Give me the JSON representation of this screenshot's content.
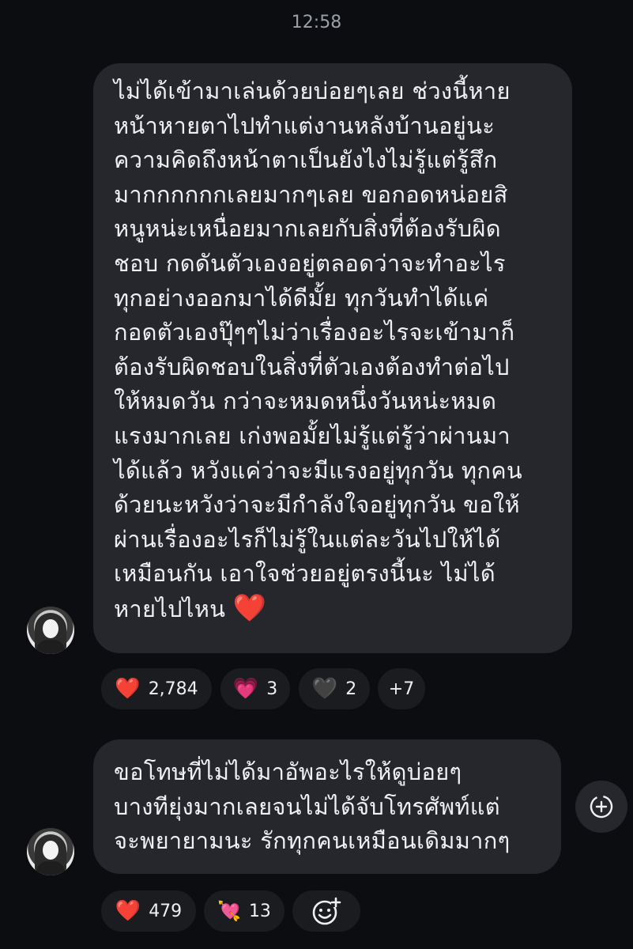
{
  "timestamp": "12:58",
  "messages": [
    {
      "lines": [
        "ไม่ได้เข้ามาเล่นด้วยบ่อยๆเลย ช่วงนี้หาย",
        "หน้าหายตาไปทำแต่งานหลังบ้านอยู่นะ",
        "ความคิดถึงหน้าตาเป็นยังไงไม่รู้แต่รู้สึก",
        "มากกกกกกเลยมากๆเลย ขอกอดหน่อยสิ",
        "หนูหน่ะเหนื่อยมากเลยกับสิ่งที่ต้องรับผิด",
        "ชอบ กดดันตัวเองอยู่ตลอดว่าจะทำอะไร",
        "ทุกอย่างออกมาได้ดีมั้ย ทุกวันทำได้แค่",
        "กอดตัวเองปุ๊ๆๆไม่ว่าเรื่องอะไรจะเข้ามาก็",
        "ต้องรับผิดชอบในสิ่งที่ตัวเองต้องทำต่อไป",
        "ให้หมดวัน กว่าจะหมดหนึ่งวันหน่ะหมด",
        "แรงมากเลย เก่งพอมั้ยไม่รู้แต่รู้ว่าผ่านมา",
        "ได้แล้ว หวังแค่ว่าจะมีแรงอยู่ทุกวัน ทุกคน",
        "ด้วยนะหวังว่าจะมีกำลังใจอยู่ทุกวัน ขอให้",
        "ผ่านเรื่องอะไรก็ไม่รู้ในแต่ละวันไปให้ได้",
        "เหมือนกัน เอาใจช่วยอยู่ตรงนี้นะ ไม่ได้",
        "หายไปไหน"
      ],
      "inline_emoji": "❤️",
      "reactions": [
        {
          "emoji": "❤️",
          "count": "2,784"
        },
        {
          "emoji": "💗",
          "count": "3"
        },
        {
          "emoji": "🖤",
          "count": "2"
        },
        {
          "emoji": "",
          "count": "+7"
        }
      ]
    },
    {
      "lines": [
        "ขอโทษที่ไม่ได้มาอัพอะไรให้ดูบ่อยๆ",
        "บางทียุ่งมากเลยจนไม่ได้จับโทรศัพท์แต่",
        "จะพยายามนะ รักทุกคนเหมือนเดิมมากๆ"
      ],
      "reactions": [
        {
          "emoji": "❤️",
          "count": "479"
        },
        {
          "emoji": "💘",
          "count": "13"
        }
      ]
    }
  ],
  "icons": {
    "add_reaction": "smile-plus-icon",
    "share": "share-icon"
  },
  "colors": {
    "background": "#0c0d10",
    "bubble": "#25272c",
    "pill": "#1a1c20",
    "text": "#eef0f3",
    "timestamp": "#9aa0a6"
  }
}
